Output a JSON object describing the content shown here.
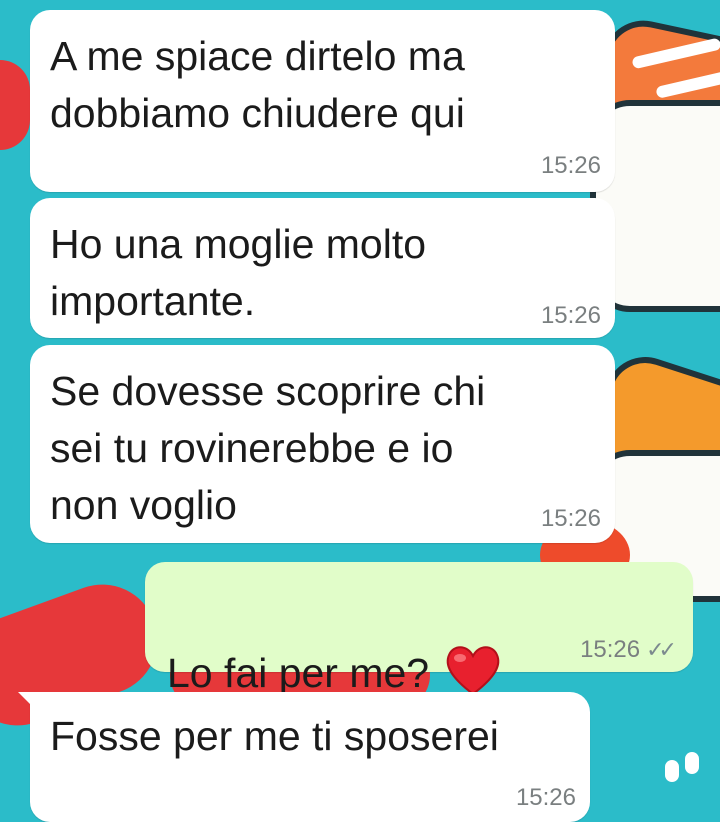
{
  "messages": [
    {
      "id": "m1",
      "direction": "incoming",
      "text": "A me spiace dirtelo ma\ndobbiamo chiudere qui",
      "time": "15:26"
    },
    {
      "id": "m2",
      "direction": "incoming",
      "text": "Ho una moglie molto\nimportante.",
      "time": "15:26"
    },
    {
      "id": "m3",
      "direction": "incoming",
      "text": "Se dovesse scoprire chi\nsei tu rovinerebbe e io\nnon voglio",
      "time": "15:26"
    },
    {
      "id": "m4",
      "direction": "outgoing",
      "text": "Lo fai per me?",
      "emoji": "heart-emoji",
      "time": "15:26",
      "status": "read-double-check"
    },
    {
      "id": "m5",
      "direction": "incoming",
      "text": "Fosse per me ti sposerei",
      "time": "15:26"
    }
  ],
  "colors": {
    "wallpaper": "#2bbcc9",
    "incoming_bubble": "#ffffff",
    "outgoing_bubble": "#e1fdc9",
    "timestamp": "#7a7f80",
    "heart": "#e8202e"
  }
}
